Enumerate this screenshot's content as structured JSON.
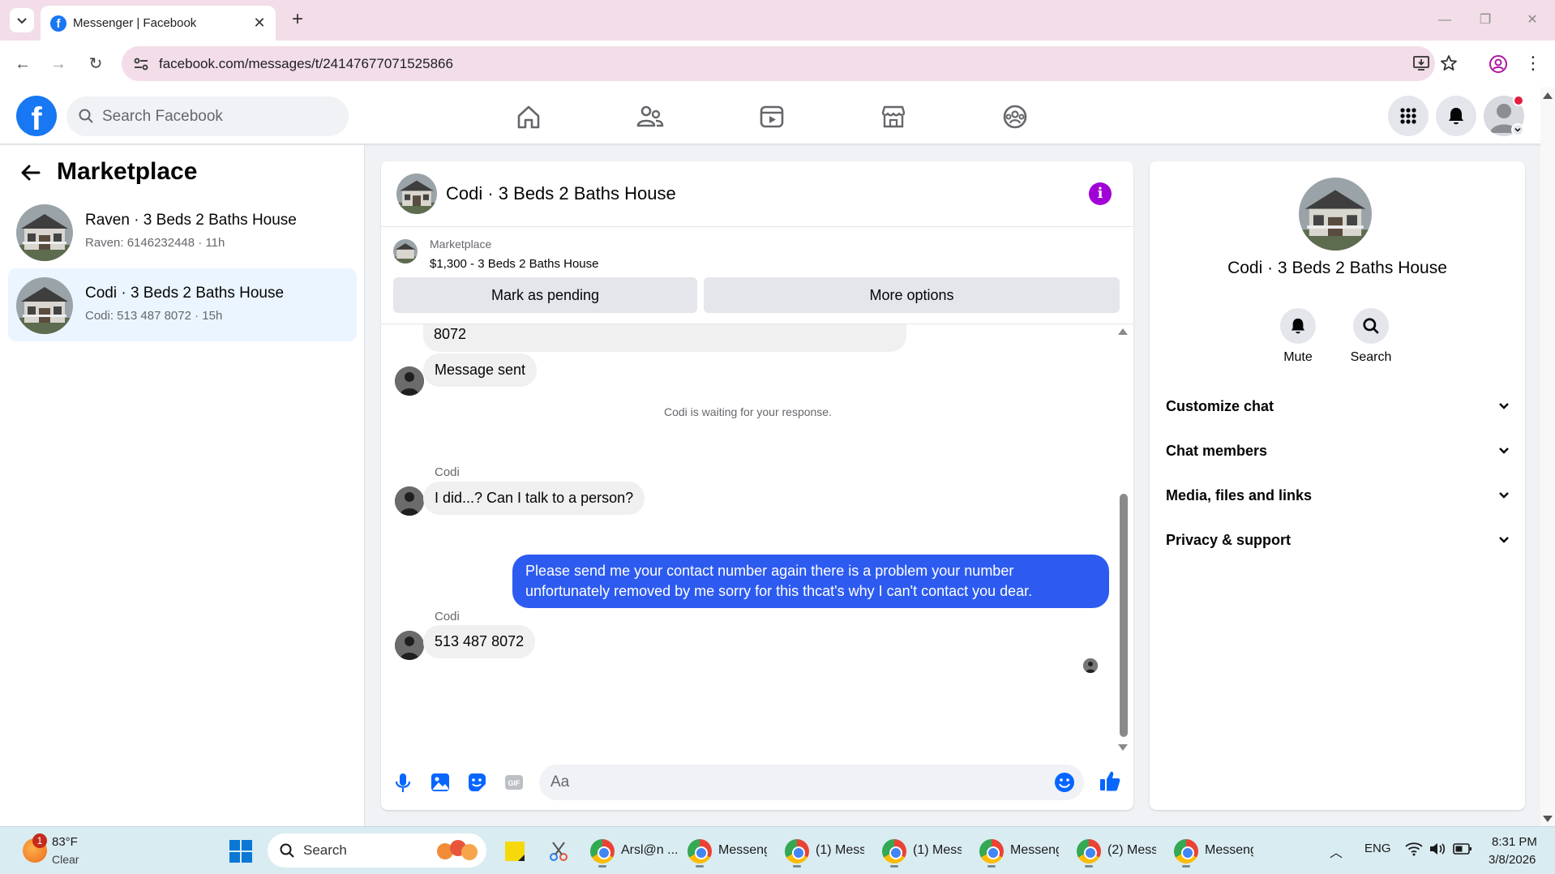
{
  "browser": {
    "tab_title": "Messenger | Facebook",
    "url": "facebook.com/messages/t/24147677071525866",
    "window_controls": [
      "minimize",
      "restore",
      "close"
    ]
  },
  "fb_header": {
    "search_placeholder": "Search Facebook",
    "nav_icons": [
      "home-icon",
      "friends-icon",
      "video-icon",
      "marketplace-icon",
      "groups-icon"
    ],
    "right_icons": [
      "menu-grid-icon",
      "notifications-icon",
      "account-avatar"
    ]
  },
  "sidebar": {
    "title": "Marketplace",
    "conversations": [
      {
        "name": "Raven · 3 Beds 2 Baths House",
        "subtitle": "Raven: 6146232448 · 11h",
        "active": false
      },
      {
        "name": "Codi · 3 Beds 2 Baths House",
        "subtitle": "Codi: 513 487 8072 · 15h",
        "active": true
      }
    ]
  },
  "chat": {
    "title": "Codi · 3 Beds 2 Baths House",
    "listing_source": "Marketplace",
    "listing_title": "$1,300 - 3 Beds 2 Baths House",
    "mark_pending_label": "Mark as pending",
    "more_options_label": "More options",
    "messages": {
      "partial_top_text": "8072",
      "message_sent": "Message sent",
      "waiting_notice": "Codi is waiting for your response.",
      "sender_1": "Codi",
      "incoming_1": "I did...? Can I talk to a person?",
      "outgoing_line_1": "Please send me your contact number again there is a problem your number",
      "outgoing_line_2": "unfortunately removed by me sorry for this thcat's why I can't contact you dear.",
      "sender_2": "Codi",
      "incoming_2": "513 487 8072"
    },
    "composer_placeholder": "Aa",
    "composer_icons": [
      "microphone-icon",
      "photo-icon",
      "sticker-icon",
      "gif-icon",
      "emoji-icon",
      "like-icon"
    ]
  },
  "details": {
    "name": "Codi · 3 Beds 2 Baths House",
    "mute_label": "Mute",
    "search_label": "Search",
    "sections": [
      "Customize chat",
      "Chat members",
      "Media, files and links",
      "Privacy & support"
    ]
  },
  "taskbar": {
    "weather_badge": "1",
    "weather_temp": "83°F",
    "weather_cond": "Clear",
    "search_label": "Search",
    "apps": [
      "Arsl@n ...",
      "Messeng",
      "(1) Mess",
      "(1) Mess",
      "Messeng",
      "(2) Mess",
      "Messeng"
    ],
    "lang": "ENG",
    "time": "8:31 PM",
    "date": "3/8/2026"
  },
  "colors": {
    "fb_blue": "#1877f2",
    "outgoing_bubble": "#2d5bf0",
    "active_conv": "#ebf5ff",
    "info_icon": "#a100d6"
  }
}
